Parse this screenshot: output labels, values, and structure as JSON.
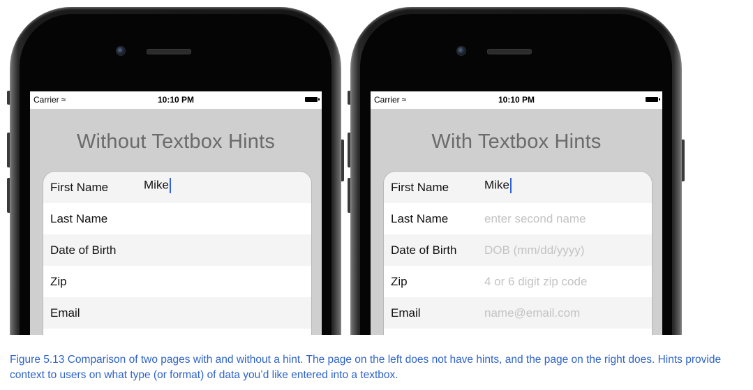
{
  "phones": [
    {
      "status": {
        "carrier": "Carrier",
        "wifi_icon": "wifi-icon",
        "time": "10:10 PM",
        "battery_icon": "battery-icon"
      },
      "title": "Without Textbox Hints",
      "fields": [
        {
          "label": "First Name",
          "value": "Mike",
          "placeholder": ""
        },
        {
          "label": "Last Name",
          "value": "",
          "placeholder": ""
        },
        {
          "label": "Date of Birth",
          "value": "",
          "placeholder": ""
        },
        {
          "label": "Zip",
          "value": "",
          "placeholder": ""
        },
        {
          "label": "Email",
          "value": "",
          "placeholder": ""
        }
      ]
    },
    {
      "status": {
        "carrier": "Carrier",
        "wifi_icon": "wifi-icon",
        "time": "10:10 PM",
        "battery_icon": "battery-icon"
      },
      "title": "With Textbox Hints",
      "fields": [
        {
          "label": "First Name",
          "value": "Mike",
          "placeholder": ""
        },
        {
          "label": "Last Name",
          "value": "",
          "placeholder": "enter second name"
        },
        {
          "label": "Date of Birth",
          "value": "",
          "placeholder": "DOB (mm/dd/yyyy)"
        },
        {
          "label": "Zip",
          "value": "",
          "placeholder": "4 or 6 digit zip code"
        },
        {
          "label": "Email",
          "value": "",
          "placeholder": "name@email.com"
        }
      ]
    }
  ],
  "caption": "Figure 5.13 Comparison of two pages with and without a hint. The page on the left does not have hints, and the page on the right does. Hints provide context to users on what type (or format) of data you’d like entered into a textbox.",
  "colors": {
    "caption": "#2e63c9",
    "caret": "#2f62d8",
    "placeholder": "#c3c3c3"
  }
}
